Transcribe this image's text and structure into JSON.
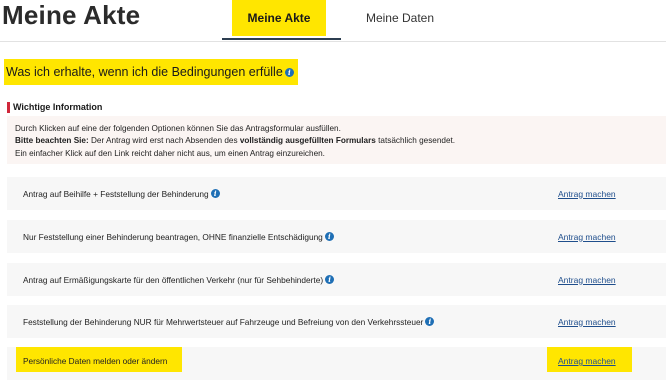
{
  "header": {
    "title": "Meine Akte",
    "tabs": [
      {
        "label": "Meine Akte",
        "active": true
      },
      {
        "label": "Meine Daten",
        "active": false
      }
    ]
  },
  "section": {
    "heading": "Was ich erhalte, wenn ich die Bedingungen erfülle",
    "info_icon": "info-icon"
  },
  "notice": {
    "title": "Wichtige Information",
    "line1": "Durch Klicken auf eine der folgenden Optionen können Sie das Antragsformular ausfüllen.",
    "line2_bold_prefix": "Bitte beachten Sie:",
    "line2_mid": " Der Antrag wird erst nach Absenden des ",
    "line2_bold_mid": "vollständig ausgefüllten Formulars",
    "line2_end": " tatsächlich gesendet.",
    "line3": "Ein einfacher Klick auf den Link reicht daher nicht aus, um einen Antrag einzureichen."
  },
  "rows": [
    {
      "label": "Antrag auf Beihilfe + Feststellung der Behinderung",
      "info": true,
      "link": "Antrag machen"
    },
    {
      "label": "Nur Feststellung einer Behinderung beantragen, OHNE finanzielle Entschädigung",
      "info": true,
      "link": "Antrag machen"
    },
    {
      "label": "Antrag auf Ermäßigungskarte für den öffentlichen Verkehr (nur für Sehbehinderte)",
      "info": true,
      "link": "Antrag machen"
    },
    {
      "label": "Feststellung der Behinderung NUR für Mehrwertsteuer auf Fahrzeuge und Befreiung von den Verkehrssteuer",
      "info": true,
      "link": "Antrag machen"
    },
    {
      "label": "Persönliche Daten melden oder ändern",
      "info": false,
      "link": "Antrag machen"
    }
  ],
  "colors": {
    "highlight": "#ffe600",
    "accent_bar": "#d0283b",
    "link": "#1f4e8c",
    "info_icon": "#1f6fb5"
  }
}
